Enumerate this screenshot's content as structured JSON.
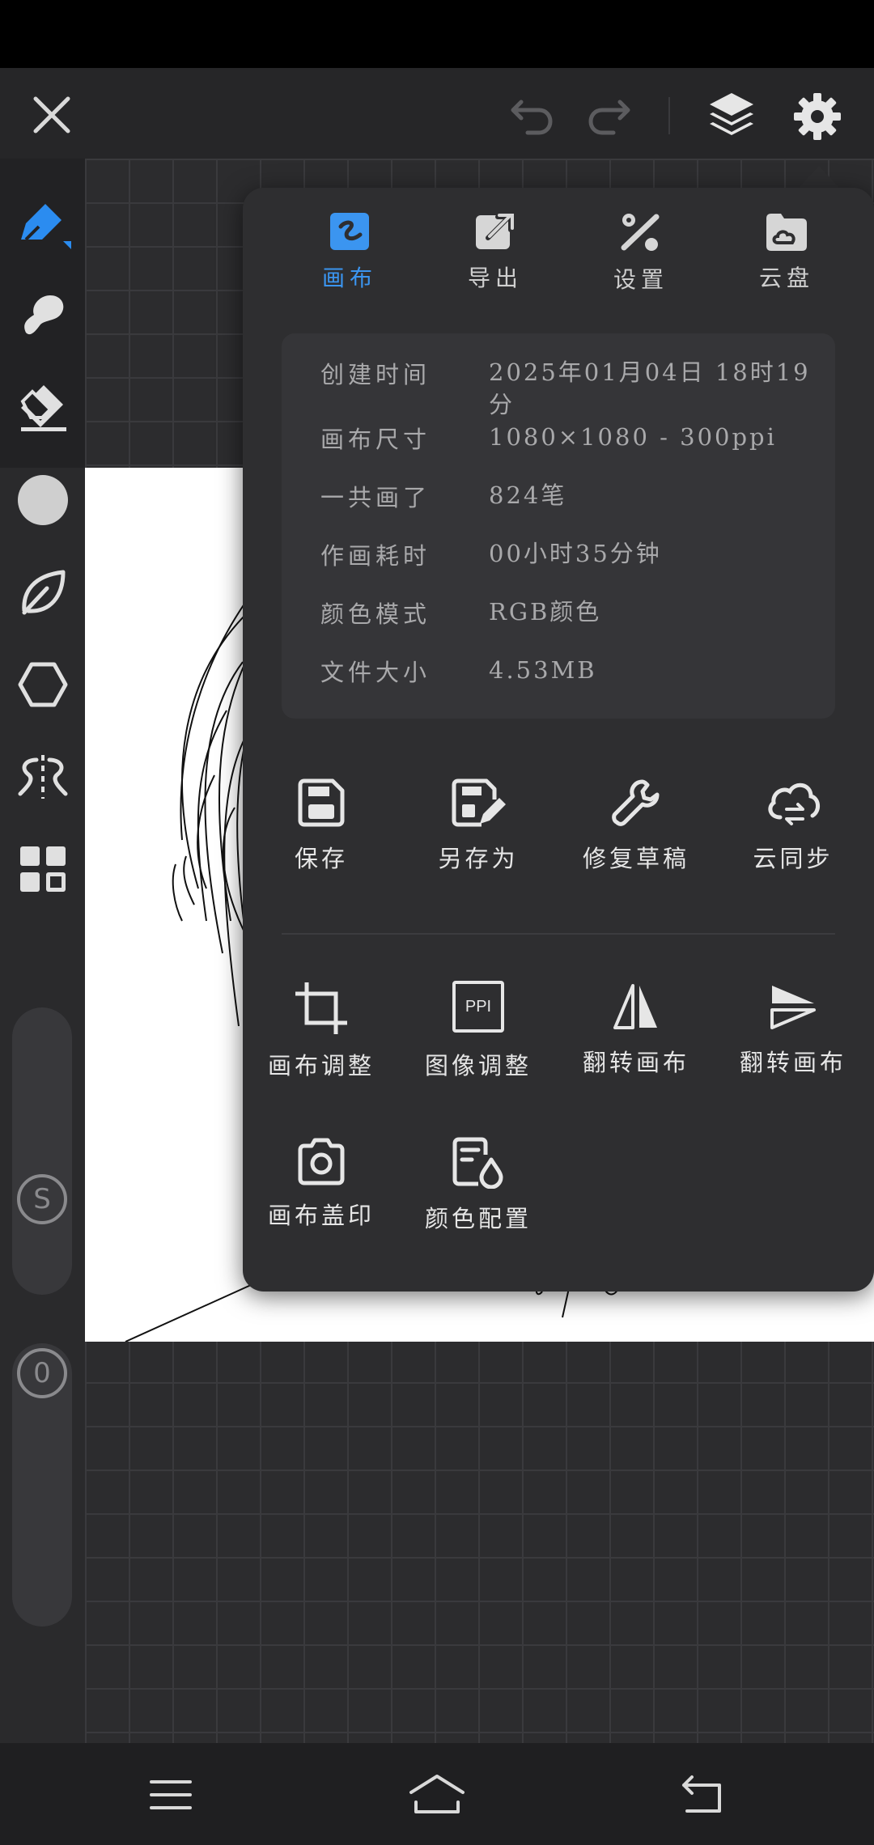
{
  "toolbar": {
    "close_icon": "close-icon",
    "undo_icon": "undo-icon",
    "redo_icon": "redo-icon",
    "layers_icon": "layers-icon",
    "settings_icon": "gear-icon"
  },
  "left_tools": [
    {
      "name": "pen",
      "icon": "pen-icon"
    },
    {
      "name": "smudge",
      "icon": "smudge-icon"
    },
    {
      "name": "eraser",
      "icon": "eraser-icon"
    },
    {
      "name": "color",
      "icon": "color-circle-icon"
    },
    {
      "name": "leaf",
      "icon": "leaf-icon"
    },
    {
      "name": "shape",
      "icon": "hexagon-icon"
    },
    {
      "name": "symmetry",
      "icon": "symmetry-icon"
    },
    {
      "name": "grid",
      "icon": "grid-icon"
    }
  ],
  "sliders": {
    "size_label": "S",
    "opacity_label": "0"
  },
  "popup": {
    "tabs": [
      {
        "label": "画布",
        "icon": "canvas-icon",
        "active": true
      },
      {
        "label": "导出",
        "icon": "export-icon",
        "active": false
      },
      {
        "label": "设置",
        "icon": "tools-icon",
        "active": false
      },
      {
        "label": "云盘",
        "icon": "cloud-disk-icon",
        "active": false
      }
    ],
    "info": [
      {
        "key": "创建时间",
        "value": "2025年01月04日 18时19分"
      },
      {
        "key": "画布尺寸",
        "value": "1080×1080 - 300ppi"
      },
      {
        "key": "一共画了",
        "value": "824笔"
      },
      {
        "key": "作画耗时",
        "value": "00小时35分钟"
      },
      {
        "key": "颜色模式",
        "value": "RGB颜色"
      },
      {
        "key": "文件大小",
        "value": "4.53MB"
      }
    ],
    "actions_row1": [
      {
        "label": "保存",
        "icon": "save-icon"
      },
      {
        "label": "另存为",
        "icon": "save-as-icon"
      },
      {
        "label": "修复草稿",
        "icon": "wrench-icon"
      },
      {
        "label": "云同步",
        "icon": "cloud-sync-icon"
      }
    ],
    "actions_row2": [
      {
        "label": "画布调整",
        "icon": "crop-icon"
      },
      {
        "label": "图像调整",
        "icon": "ppi-icon"
      },
      {
        "label": "翻转画布",
        "icon": "flip-horizontal-icon"
      },
      {
        "label": "翻转画布",
        "icon": "flip-vertical-icon"
      }
    ],
    "actions_row3": [
      {
        "label": "画布盖印",
        "icon": "camera-icon"
      },
      {
        "label": "颜色配置",
        "icon": "color-config-icon"
      }
    ],
    "ppi_badge": "PPI"
  },
  "navbar": {
    "menu_icon": "menu-icon",
    "home_icon": "home-icon",
    "back_icon": "back-icon"
  },
  "colors": {
    "accent": "#3b95f0",
    "panel": "#2e2e30",
    "info_box": "#353538"
  }
}
